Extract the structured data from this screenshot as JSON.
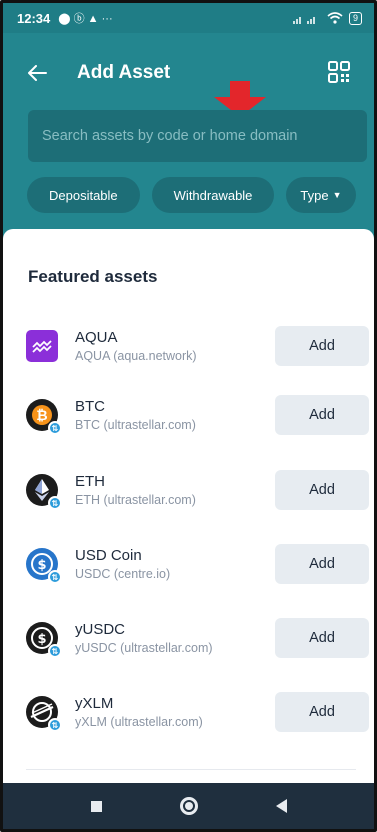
{
  "status_bar": {
    "time": "12:34",
    "left_icons": "⬤ ⓑ ▲ ···",
    "battery": "9"
  },
  "header": {
    "title": "Add Asset"
  },
  "search": {
    "placeholder": "Search assets by code or home domain",
    "value": ""
  },
  "filters": [
    {
      "label": "Depositable"
    },
    {
      "label": "Withdrawable"
    },
    {
      "label": "Type"
    }
  ],
  "section_title": "Featured assets",
  "assets": [
    {
      "code": "AQUA",
      "domain": "AQUA (aqua.network)",
      "action": "Add",
      "icon": "aqua-icon"
    },
    {
      "code": "BTC",
      "domain": "BTC (ultrastellar.com)",
      "action": "Add",
      "icon": "bitcoin-icon"
    },
    {
      "code": "ETH",
      "domain": "ETH (ultrastellar.com)",
      "action": "Add",
      "icon": "ethereum-icon"
    },
    {
      "code": "USD Coin",
      "domain": "USDC (centre.io)",
      "action": "Add",
      "icon": "usdc-icon"
    },
    {
      "code": "yUSDC",
      "domain": "yUSDC (ultrastellar.com)",
      "action": "Add",
      "icon": "yusdc-icon"
    },
    {
      "code": "yXLM",
      "domain": "yXLM (ultrastellar.com)",
      "action": "Add",
      "icon": "yxlm-icon"
    }
  ],
  "colors": {
    "teal": "#23868f",
    "search_bg": "#1d6e77",
    "annotation_arrow": "#e3262b",
    "verified_badge": "#2d9cdb"
  }
}
